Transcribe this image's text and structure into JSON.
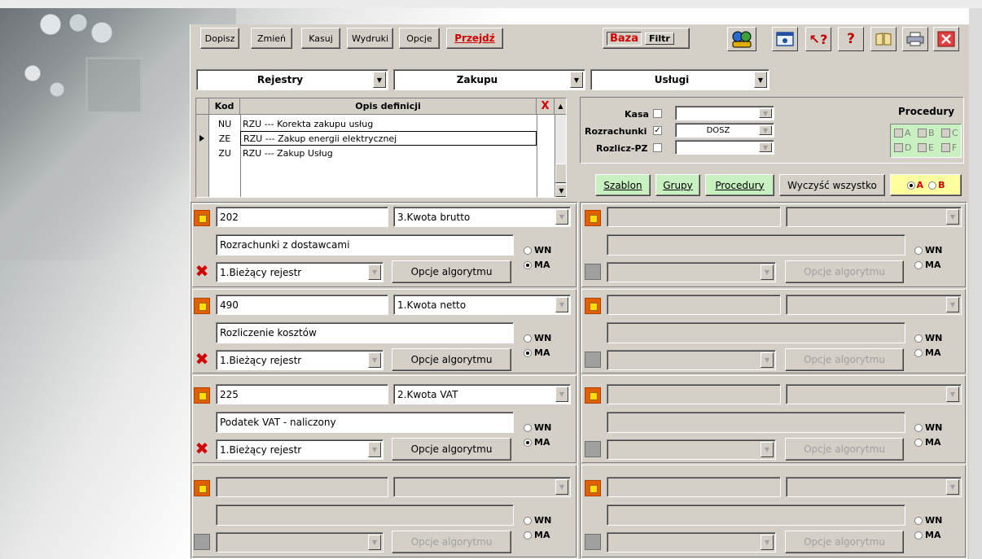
{
  "toolbar": {
    "dopisz": "Dopisz",
    "zmien": "Zmień",
    "kasuj": "Kasuj",
    "wydruki": "Wydruki",
    "opcje": "Opcje",
    "przejdz": "Przejdź",
    "baza": "Baza",
    "filtr": "Filtr"
  },
  "header": {
    "rejestry": "Rejestry",
    "zakupu": "Zakupu",
    "uslugi": "Usługi"
  },
  "table": {
    "col_kod": "Kod",
    "col_opis": "Opis definicji",
    "close_glyph": "X",
    "rows": [
      {
        "kod": "NU",
        "opis": "RZU --- Korekta zakupu usług"
      },
      {
        "kod": "ZE",
        "opis": "RZU --- Zakup energii elektrycznej"
      },
      {
        "kod": "ZU",
        "opis": "RZU --- Zakup Usług"
      }
    ],
    "selected_index": 1
  },
  "options": {
    "kasa_label": "Kasa",
    "kasa_checked": false,
    "kasa_value": "",
    "rozrachunki_label": "Rozrachunki",
    "rozrachunki_checked": true,
    "rozrachunki_value": "DOSZ",
    "rozliczpz_label": "Rozlicz-PZ",
    "rozliczpz_checked": false,
    "rozliczpz_value": "",
    "procedury_label": "Procedury",
    "proc_letters": [
      "A",
      "B",
      "C",
      "D",
      "E",
      "F"
    ]
  },
  "actions": {
    "szablon": "Szablon",
    "grupy": "Grupy",
    "procedury": "Procedury",
    "wyczysc": "Wyczyść wszystko",
    "opt_a": "A",
    "opt_b": "B",
    "selected": "A"
  },
  "entries_left": [
    {
      "account": "202",
      "amount_type": "3.Kwota brutto",
      "name": "Rozrachunki z dostawcami",
      "register": "1.Bieżący rejestr",
      "algo": "Opcje algorytmu",
      "side": "MA",
      "active": true
    },
    {
      "account": "490",
      "amount_type": "1.Kwota netto",
      "name": "Rozliczenie kosztów",
      "register": "1.Bieżący rejestr",
      "algo": "Opcje algorytmu",
      "side": "MA",
      "active": true
    },
    {
      "account": "225",
      "amount_type": "2.Kwota VAT",
      "name": "Podatek VAT - naliczony",
      "register": "1.Bieżący rejestr",
      "algo": "Opcje algorytmu",
      "side": "MA",
      "active": true
    },
    {
      "account": "",
      "amount_type": "",
      "name": "",
      "register": "",
      "algo": "Opcje algorytmu",
      "side": "",
      "active": false
    }
  ],
  "entries_right": [
    {
      "algo": "Opcje algorytmu"
    },
    {
      "algo": "Opcje algorytmu"
    },
    {
      "algo": "Opcje algorytmu"
    },
    {
      "algo": "Opcje algorytmu"
    }
  ],
  "side_labels": {
    "wn": "WN",
    "ma": "MA"
  }
}
